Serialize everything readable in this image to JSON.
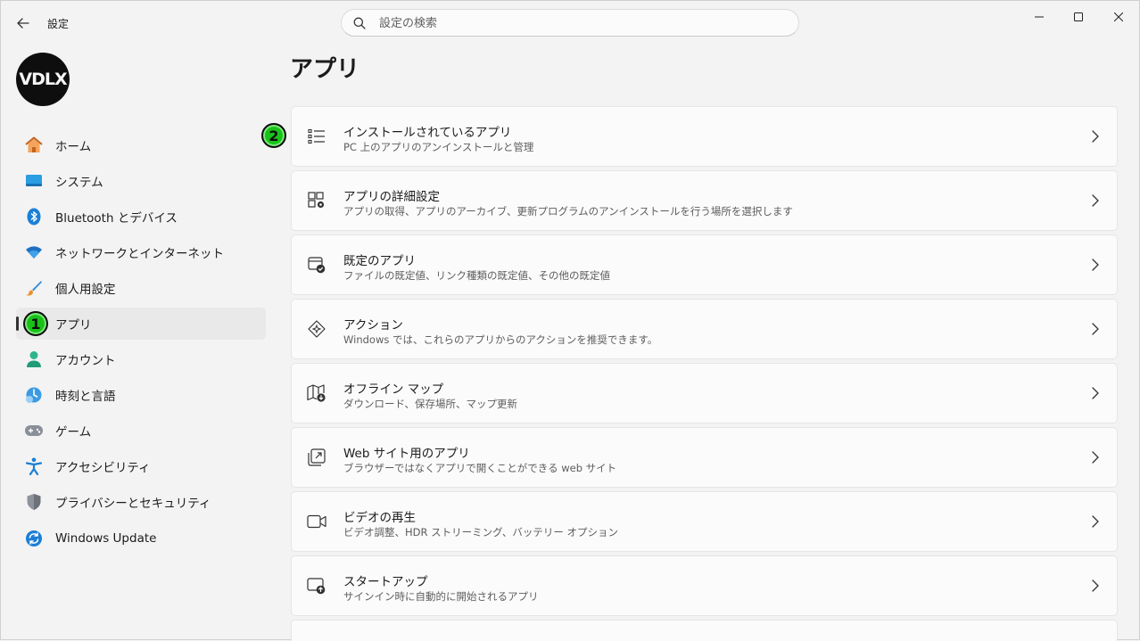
{
  "window": {
    "title": "設定",
    "search_placeholder": "設定の検索"
  },
  "account": {
    "avatar_text": "VDLX"
  },
  "sidebar": {
    "items": [
      {
        "label": "ホーム",
        "icon": "home-icon"
      },
      {
        "label": "システム",
        "icon": "system-icon"
      },
      {
        "label": "Bluetooth とデバイス",
        "icon": "bluetooth-icon"
      },
      {
        "label": "ネットワークとインターネット",
        "icon": "wifi-icon"
      },
      {
        "label": "個人用設定",
        "icon": "brush-icon"
      },
      {
        "label": "アプリ",
        "icon": "apps-icon",
        "active": true
      },
      {
        "label": "アカウント",
        "icon": "account-icon"
      },
      {
        "label": "時刻と言語",
        "icon": "time-language-icon"
      },
      {
        "label": "ゲーム",
        "icon": "gamepad-icon"
      },
      {
        "label": "アクセシビリティ",
        "icon": "accessibility-icon"
      },
      {
        "label": "プライバシーとセキュリティ",
        "icon": "shield-icon"
      },
      {
        "label": "Windows Update",
        "icon": "update-icon"
      }
    ]
  },
  "annotations": {
    "badge_1": "1",
    "badge_2": "2"
  },
  "main": {
    "title": "アプリ",
    "cards": [
      {
        "title": "インストールされているアプリ",
        "subtitle": "PC 上のアプリのアンインストールと管理",
        "icon": "list-icon"
      },
      {
        "title": "アプリの詳細設定",
        "subtitle": "アプリの取得、アプリのアーカイブ、更新プログラムのアンインストールを行う場所を選択します",
        "icon": "app-settings-icon"
      },
      {
        "title": "既定のアプリ",
        "subtitle": "ファイルの既定値、リンク種類の既定値、その他の既定値",
        "icon": "default-apps-icon"
      },
      {
        "title": "アクション",
        "subtitle": "Windows では、これらのアプリからのアクションを推奨できます。",
        "icon": "actions-icon"
      },
      {
        "title": "オフライン マップ",
        "subtitle": "ダウンロード、保存場所、マップ更新",
        "icon": "offline-map-icon"
      },
      {
        "title": "Web サイト用のアプリ",
        "subtitle": "ブラウザーではなくアプリで開くことができる web サイト",
        "icon": "open-external-icon"
      },
      {
        "title": "ビデオの再生",
        "subtitle": "ビデオ調整、HDR ストリーミング、バッテリー オプション",
        "icon": "video-icon"
      },
      {
        "title": "スタートアップ",
        "subtitle": "サインイン時に自動的に開始されるアプリ",
        "icon": "startup-icon"
      },
      {
        "title": "",
        "subtitle": "",
        "icon": ""
      }
    ]
  }
}
